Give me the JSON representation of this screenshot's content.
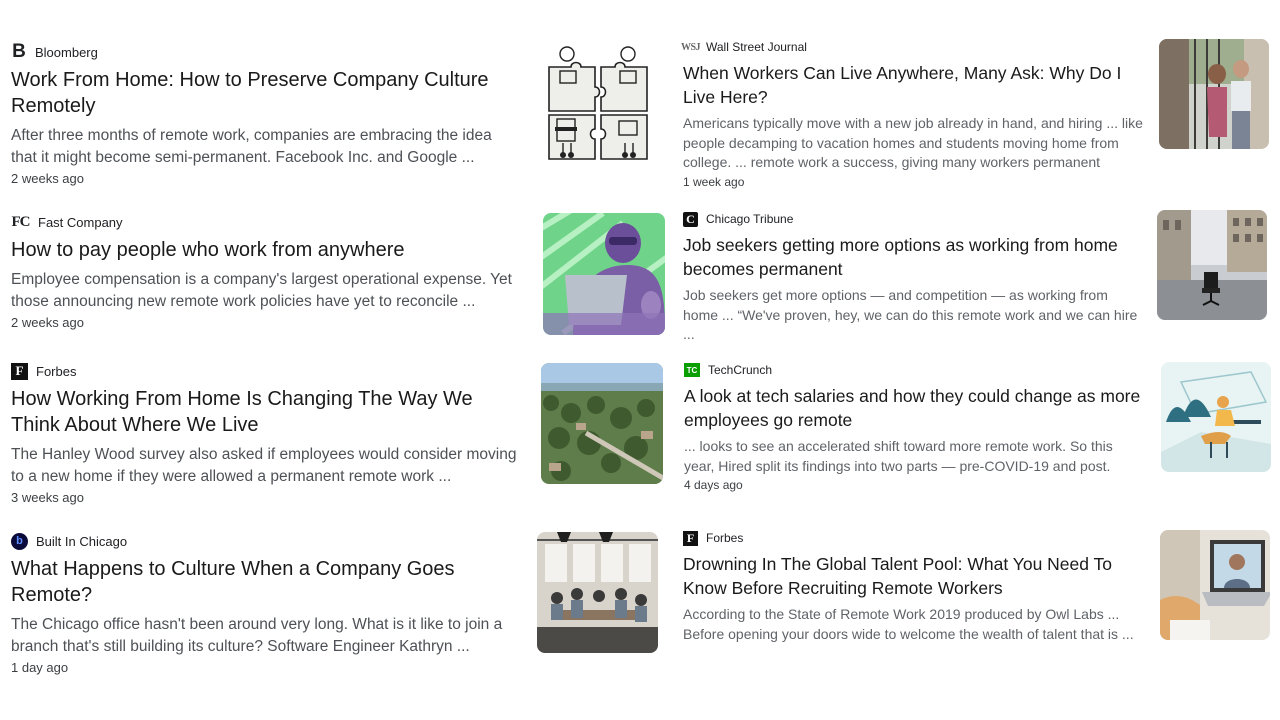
{
  "articles": [
    {
      "source": "Bloomberg",
      "logo_text": "B",
      "title": "Work From Home: How to Preserve Company Culture Remotely",
      "snippet": "After three months of remote work, companies are embracing the idea that it might become semi-permanent. Facebook Inc. and Google ...",
      "date": "2 weeks ago",
      "thumb": "puzzle-workers-illustration"
    },
    {
      "source": "Wall Street Journal",
      "logo_text": "WSJ",
      "title": "When Workers Can Live Anywhere, Many Ask: Why Do I Live Here?",
      "snippet": "Americans typically move with a new job already in hand, and hiring ... like people decamping to vacation homes and students moving home from college. ... remote work a success, giving many workers permanent",
      "date": "1 week ago",
      "thumb": "couple-on-street-photo"
    },
    {
      "source": "Fast Company",
      "logo_text": "FC",
      "title": "How to pay people who work from anywhere",
      "snippet": "Employee compensation is a company's largest operational expense. Yet those announcing new remote work policies have yet to reconcile ...",
      "date": "2 weeks ago",
      "thumb": "man-with-laptop-green-photo"
    },
    {
      "source": "Chicago Tribune",
      "logo_text": "C",
      "title": "Job seekers getting more options as working from home becomes permanent",
      "snippet": "Job seekers get more options — and competition — as working from home ... “We've proven, hey, we can do this remote work and we can hire ...",
      "date": "",
      "thumb": "office-chair-on-street-photo"
    },
    {
      "source": "Forbes",
      "logo_text": "F",
      "title": "How Working From Home Is Changing The Way We Think About Where We Live",
      "snippet": "The Hanley Wood survey also asked if employees would consider moving to a new home if they were allowed a permanent remote work ...",
      "date": "3 weeks ago",
      "thumb": "aerial-suburb-photo"
    },
    {
      "source": "TechCrunch",
      "logo_text": "TC",
      "title": "A look at tech salaries and how they could change as more employees go remote",
      "snippet": "... looks to see an accelerated shift toward more remote work. So this year, Hired split its findings into two parts — pre-COVID-19 and post.",
      "date": "4 days ago",
      "thumb": "remote-worker-illustration"
    },
    {
      "source": "Built In Chicago",
      "logo_text": "b",
      "title": "What Happens to Culture When a Company Goes Remote?",
      "snippet": "The Chicago office hasn't been around very long. What is it like to join a branch that's still building its culture? Software Engineer Kathryn ...",
      "date": "1 day ago",
      "thumb": "office-team-photo"
    },
    {
      "source": "Forbes",
      "logo_text": "F",
      "title": "Drowning In The Global Talent Pool: What You Need To Know Before Recruiting Remote Workers",
      "snippet": "According to the State of Remote Work 2019 produced by Owl Labs ... Before opening your doors wide to welcome the wealth of talent that is ...",
      "date": "",
      "thumb": "video-call-laptop-photo"
    }
  ],
  "colors": {
    "logo_dark": "#111111",
    "techcrunch_green": "#0a9e01",
    "builtin_blue": "#1c3fd6",
    "snippet_gray": "#4d5156"
  }
}
